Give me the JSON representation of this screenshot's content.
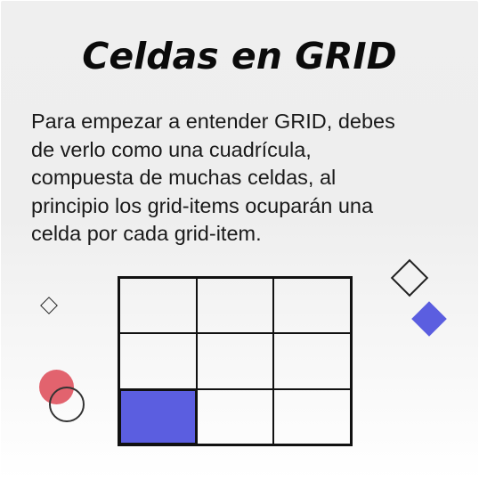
{
  "slide": {
    "title": "Celdas en GRID",
    "body_lines": [
      "Para empezar a entender GRID, debes",
      "de verlo como una cuadrícula,",
      "compuesta de muchas celdas, al",
      "principio los grid-items ocuparán una",
      "celda por cada grid-item."
    ]
  },
  "grid_illustration": {
    "rows": 3,
    "columns": 3,
    "highlighted_cell": {
      "row": 3,
      "column": 1
    },
    "highlight_color": "#5b5ee0",
    "line_color": "#111111"
  },
  "decorations": {
    "accent_blue": "#5b5ee0",
    "accent_red": "#e2636e",
    "shapes": [
      "diamond-outline",
      "diamond-outline",
      "diamond-filled",
      "circle-filled",
      "circle-outline"
    ]
  }
}
